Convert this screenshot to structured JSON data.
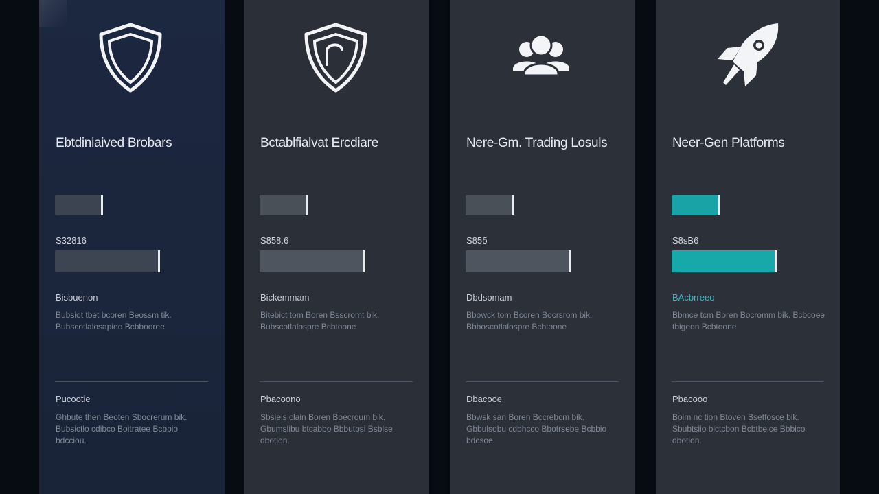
{
  "columns": [
    {
      "title": "Ebtdiniaived Brobars",
      "icon": "shield-icon",
      "price": "S32816",
      "features_label": "Bisbuenon",
      "features_text": "Bubsiot tbet bcoren Beossm tik. Bubscotlalosapieo Bcbbooree",
      "notes_label": "Pucootie",
      "notes_text": "Ghbute then Beoten Sbocrerum bik. Bubsictlo cdibco Boitratee Bcbbio bdcciou."
    },
    {
      "title": "Bctablfialvat Ercdiare",
      "icon": "shield-lock-icon",
      "price": "S858.6",
      "features_label": "Bickemmam",
      "features_text": "Bitebict tom Boren Bsscromt bik. Bubscotlalospre Bcbtoone",
      "notes_label": "Pbacoono",
      "notes_text": "Sbsieis clain Boren Boecroum bik. Gbumslibu btcabbo Bbbutbsi Bsblse dbotion."
    },
    {
      "title": "Nere-Gm. Trading Losuls",
      "icon": "users-icon",
      "price": "S85б",
      "features_label": "Dbdsomam",
      "features_text": "Bbowck tom Bcoren Bocrsrom bik. Bbboscotlalospre Bcbtoone",
      "notes_label": "Dbacooe",
      "notes_text": "Bbwsk san Boren Bccrebcm bik. Gbbulsobu cdbhcco Bbotrsebe Bcbbio bdcsoe."
    },
    {
      "title": "Neer-Gen Platforms",
      "icon": "rocket-icon",
      "price": "S8sB6",
      "features_label": "BAcbrreeo",
      "features_text": "Bbmce tcm Boren Bocromm bik. Bcbcoee tbigeon Bcbtoone",
      "notes_label": "Pbacooo",
      "notes_text": "Boim nc tion Btoven Bsetfosce bik. Sbubtsiio blctcbon Bcbtbeice Bbbico dbotion."
    }
  ],
  "colors": {
    "accent_teal": "#19a3a7",
    "page_background": "#070b12",
    "column_navy": "#1c2740",
    "column_gray": "#2a2f38"
  }
}
